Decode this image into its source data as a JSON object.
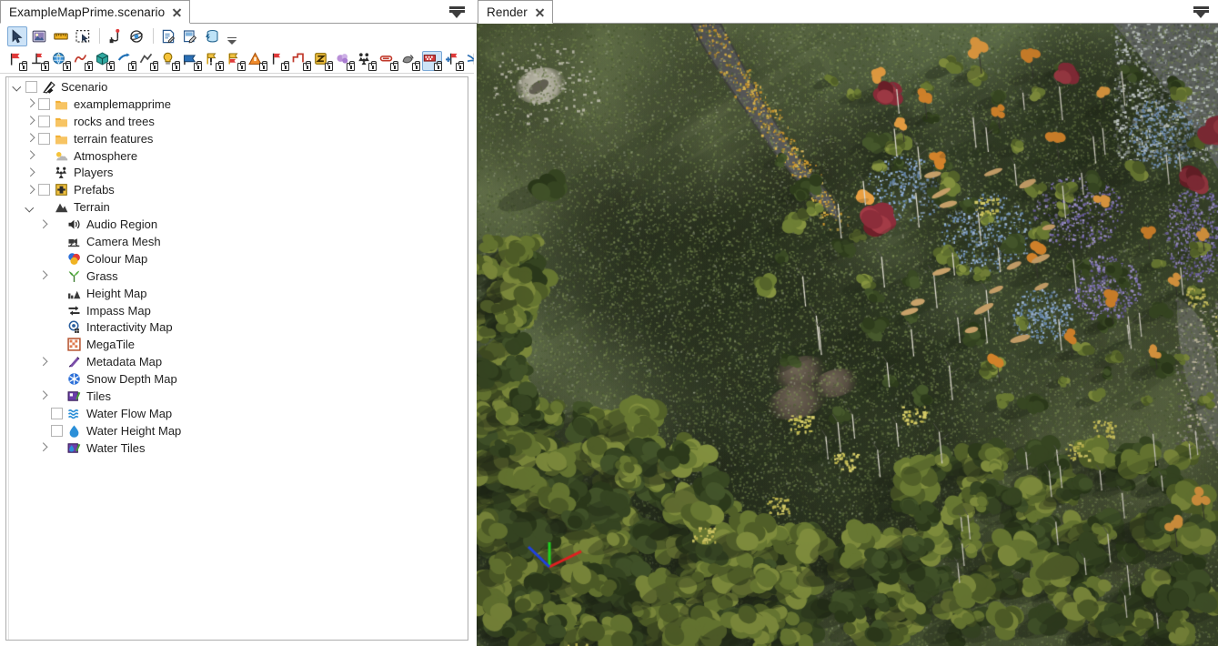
{
  "window": {
    "title": "ExampleMapPrime.scenario"
  },
  "left_dock": {
    "tab": {
      "label": "ExampleMapPrime.scenario",
      "close_icon": "close-icon"
    },
    "tab_menu_icon": "tab-list-dropdown-icon"
  },
  "right_dock": {
    "tab": {
      "label": "Render",
      "close_icon": "close-icon"
    },
    "tab_menu_icon": "tab-list-dropdown-icon"
  },
  "toolbar_row1": {
    "items": [
      {
        "icon": "select-cursor-icon",
        "selected": true
      },
      {
        "icon": "image-texture-icon",
        "selected": false
      },
      {
        "icon": "ruler-measure-icon",
        "selected": false
      },
      {
        "icon": "marquee-select-icon",
        "selected": false
      },
      {
        "separator": true
      },
      {
        "icon": "path-node-icon",
        "selected": false
      },
      {
        "icon": "orbit-rotate-icon",
        "selected": false
      },
      {
        "separator": true
      },
      {
        "icon": "script-document-icon",
        "selected": false
      },
      {
        "icon": "edit-document-icon",
        "selected": false
      },
      {
        "icon": "database-refresh-icon",
        "selected": false
      }
    ],
    "overflow_icon": "toolbar-overflow-icon"
  },
  "toolbar_row2": {
    "items": [
      {
        "icon": "flag-red-lock-icon",
        "selected": false
      },
      {
        "icon": "flag-marker-lock-icon",
        "selected": false
      },
      {
        "icon": "globe-lock-icon",
        "selected": false
      },
      {
        "icon": "curve-path-lock-icon",
        "selected": false
      },
      {
        "icon": "cube-teal-lock-icon",
        "selected": false
      },
      {
        "icon": "arrow-blue-lock-icon",
        "selected": false
      },
      {
        "icon": "line-path-lock-icon",
        "selected": false
      },
      {
        "icon": "lightbulb-lock-icon",
        "selected": false
      },
      {
        "icon": "banner-blue-lock-icon",
        "selected": false
      },
      {
        "icon": "objective-alert-lock-icon",
        "selected": false
      },
      {
        "icon": "objective-flag-lock-icon",
        "selected": false
      },
      {
        "icon": "cone-orange-lock-icon",
        "selected": false
      },
      {
        "icon": "flag-red-small-lock-icon",
        "selected": false
      },
      {
        "icon": "wave-path-lock-icon",
        "selected": false
      },
      {
        "icon": "zone-yellow-lock-icon",
        "selected": false
      },
      {
        "icon": "cloud-purple-lock-icon",
        "selected": false
      },
      {
        "icon": "squad-units-lock-icon",
        "selected": false
      },
      {
        "icon": "vehicle-lock-icon",
        "selected": false
      },
      {
        "icon": "smoke-grey-lock-icon",
        "selected": false
      },
      {
        "icon": "capture-point-lock-icon",
        "selected": true
      },
      {
        "icon": "add-flag-lock-icon",
        "selected": false
      },
      {
        "icon": "spawn-flag-lock-icon",
        "selected": false
      }
    ],
    "overflow_icon": "toolbar-overflow-icon"
  },
  "tree": {
    "nodes": [
      {
        "label": "Scenario",
        "depth": 0,
        "expander": "down",
        "checkbox": true,
        "icon": "scenario-brush-icon"
      },
      {
        "label": "examplemapprime",
        "depth": 1,
        "expander": "right",
        "checkbox": true,
        "icon": "folder-icon"
      },
      {
        "label": "rocks and trees",
        "depth": 1,
        "expander": "right",
        "checkbox": true,
        "icon": "folder-icon"
      },
      {
        "label": "terrain features",
        "depth": 1,
        "expander": "right",
        "checkbox": true,
        "icon": "folder-icon"
      },
      {
        "label": "Atmosphere",
        "depth": 1,
        "expander": "right",
        "checkbox": false,
        "icon": "atmosphere-cloud-sun-icon"
      },
      {
        "label": "Players",
        "depth": 1,
        "expander": "right",
        "checkbox": false,
        "icon": "players-icon"
      },
      {
        "label": "Prefabs",
        "depth": 1,
        "expander": "right",
        "checkbox": true,
        "icon": "prefabs-icon"
      },
      {
        "label": "Terrain",
        "depth": 1,
        "expander": "down",
        "checkbox": false,
        "icon": "terrain-mountain-icon"
      },
      {
        "label": "Audio Region",
        "depth": 2,
        "expander": "right",
        "checkbox": false,
        "icon": "audio-speaker-icon"
      },
      {
        "label": "Camera Mesh",
        "depth": 2,
        "expander": "none",
        "checkbox": false,
        "icon": "camera-mesh-icon"
      },
      {
        "label": "Colour Map",
        "depth": 2,
        "expander": "none",
        "checkbox": false,
        "icon": "colour-map-icon"
      },
      {
        "label": "Grass",
        "depth": 2,
        "expander": "right",
        "checkbox": false,
        "icon": "grass-icon"
      },
      {
        "label": "Height Map",
        "depth": 2,
        "expander": "none",
        "checkbox": false,
        "icon": "height-map-icon"
      },
      {
        "label": "Impass Map",
        "depth": 2,
        "expander": "none",
        "checkbox": false,
        "icon": "impass-map-icon"
      },
      {
        "label": "Interactivity Map",
        "depth": 2,
        "expander": "none",
        "checkbox": false,
        "icon": "interactivity-map-icon"
      },
      {
        "label": "MegaTile",
        "depth": 2,
        "expander": "none",
        "checkbox": false,
        "icon": "megatile-icon"
      },
      {
        "label": "Metadata Map",
        "depth": 2,
        "expander": "right",
        "checkbox": false,
        "icon": "metadata-map-icon"
      },
      {
        "label": "Snow Depth Map",
        "depth": 2,
        "expander": "none",
        "checkbox": false,
        "icon": "snow-depth-map-icon"
      },
      {
        "label": "Tiles",
        "depth": 2,
        "expander": "right",
        "checkbox": false,
        "icon": "tiles-icon"
      },
      {
        "label": "Water Flow Map",
        "depth": 2,
        "expander": "none",
        "checkbox": true,
        "icon": "water-flow-map-icon"
      },
      {
        "label": "Water Height Map",
        "depth": 2,
        "expander": "none",
        "checkbox": true,
        "icon": "water-height-map-icon"
      },
      {
        "label": "Water Tiles",
        "depth": 2,
        "expander": "right",
        "checkbox": false,
        "icon": "water-tiles-icon"
      }
    ]
  },
  "render": {
    "scene_description": "Top-down 3D terrain render: green grassland with forest, rocks, river and autumn trees",
    "gizmo": {
      "name": "origin-axis-gizmo",
      "axes": [
        {
          "axis": "x",
          "color": "#e02020"
        },
        {
          "axis": "y",
          "color": "#20d020"
        },
        {
          "axis": "z",
          "color": "#2040e0"
        }
      ]
    },
    "colors": {
      "grass_light": "#7d8f59",
      "grass_mid": "#67784a",
      "grass_dark": "#4a5635",
      "forest": "#53632f",
      "rock": "#6a6a66",
      "water": "#8f9a96",
      "autumn_orange": "#d4883a",
      "autumn_red": "#8e2f3c",
      "flower_purple": "#7a6fa8"
    }
  }
}
